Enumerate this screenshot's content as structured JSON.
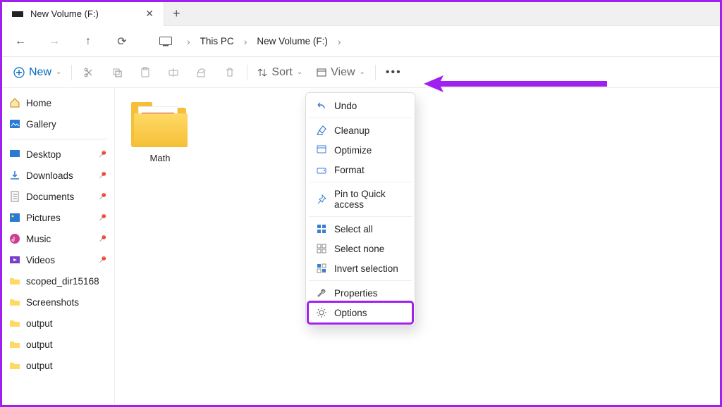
{
  "tab": {
    "title": "New Volume (F:)"
  },
  "breadcrumb": {
    "pc": "This PC",
    "drive": "New Volume (F:)"
  },
  "toolbar": {
    "new": "New",
    "sort": "Sort",
    "view": "View"
  },
  "sidebar": {
    "home": "Home",
    "gallery": "Gallery",
    "items": [
      {
        "label": "Desktop"
      },
      {
        "label": "Downloads"
      },
      {
        "label": "Documents"
      },
      {
        "label": "Pictures"
      },
      {
        "label": "Music"
      },
      {
        "label": "Videos"
      },
      {
        "label": "scoped_dir15168"
      },
      {
        "label": "Screenshots"
      },
      {
        "label": "output"
      },
      {
        "label": "output"
      },
      {
        "label": "output"
      }
    ]
  },
  "content": {
    "folder": "Math"
  },
  "menu": {
    "undo": "Undo",
    "cleanup": "Cleanup",
    "optimize": "Optimize",
    "format": "Format",
    "pin": "Pin to Quick access",
    "select_all": "Select all",
    "select_none": "Select none",
    "invert": "Invert selection",
    "properties": "Properties",
    "options": "Options"
  }
}
